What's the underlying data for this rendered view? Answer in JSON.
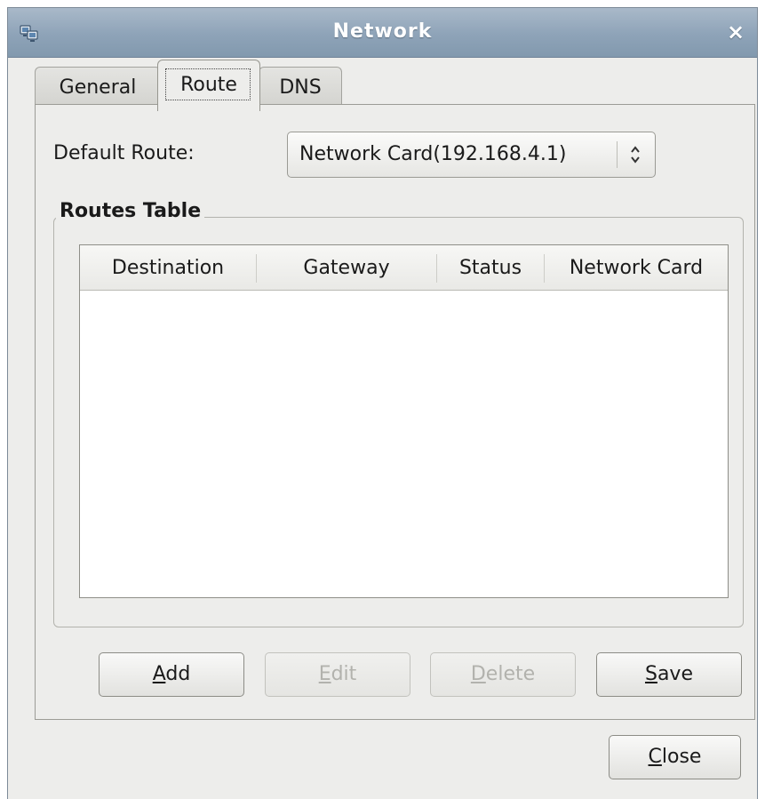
{
  "window": {
    "title": "Network",
    "close_glyph": "×",
    "icon": "network-app-icon"
  },
  "tabs": [
    {
      "label": "General",
      "selected": false
    },
    {
      "label": "Route",
      "selected": true
    },
    {
      "label": "DNS",
      "selected": false
    }
  ],
  "default_route": {
    "label": "Default Route:",
    "value": "Network Card(192.168.4.1)",
    "arrows_glyph": "⌃⌄"
  },
  "routes_table": {
    "group_title": "Routes Table",
    "columns": [
      "Destination",
      "Gateway",
      "Status",
      "Network Card"
    ],
    "rows": []
  },
  "buttons": {
    "add": {
      "mnemonic": "A",
      "rest": "dd",
      "enabled": true
    },
    "edit": {
      "mnemonic": "E",
      "rest": "dit",
      "enabled": false
    },
    "delete": {
      "mnemonic": "D",
      "rest": "elete",
      "enabled": false
    },
    "save": {
      "mnemonic": "S",
      "rest": "ave",
      "enabled": true
    },
    "close": {
      "mnemonic": "C",
      "rest": "lose",
      "enabled": true
    }
  },
  "colors": {
    "titlebar": "#8ea3b8",
    "window_bg": "#ededeb",
    "disabled_text": "#b2b2ad"
  }
}
